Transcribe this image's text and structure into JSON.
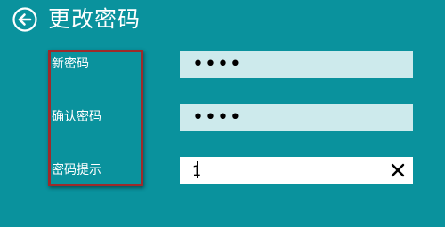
{
  "header": {
    "title": "更改密码",
    "back_icon": "arrow-left-circle-icon"
  },
  "form": {
    "new_password": {
      "label": "新密码",
      "value": "••••"
    },
    "confirm_password": {
      "label": "确认密码",
      "value": "••••"
    },
    "password_hint": {
      "label": "密码提示",
      "value": "1",
      "clear_icon": "close-icon"
    }
  },
  "colors": {
    "background": "#0a929d",
    "password_field": "#cdeaec",
    "hint_field": "#ffffff",
    "highlight": "#9e2a2a"
  }
}
